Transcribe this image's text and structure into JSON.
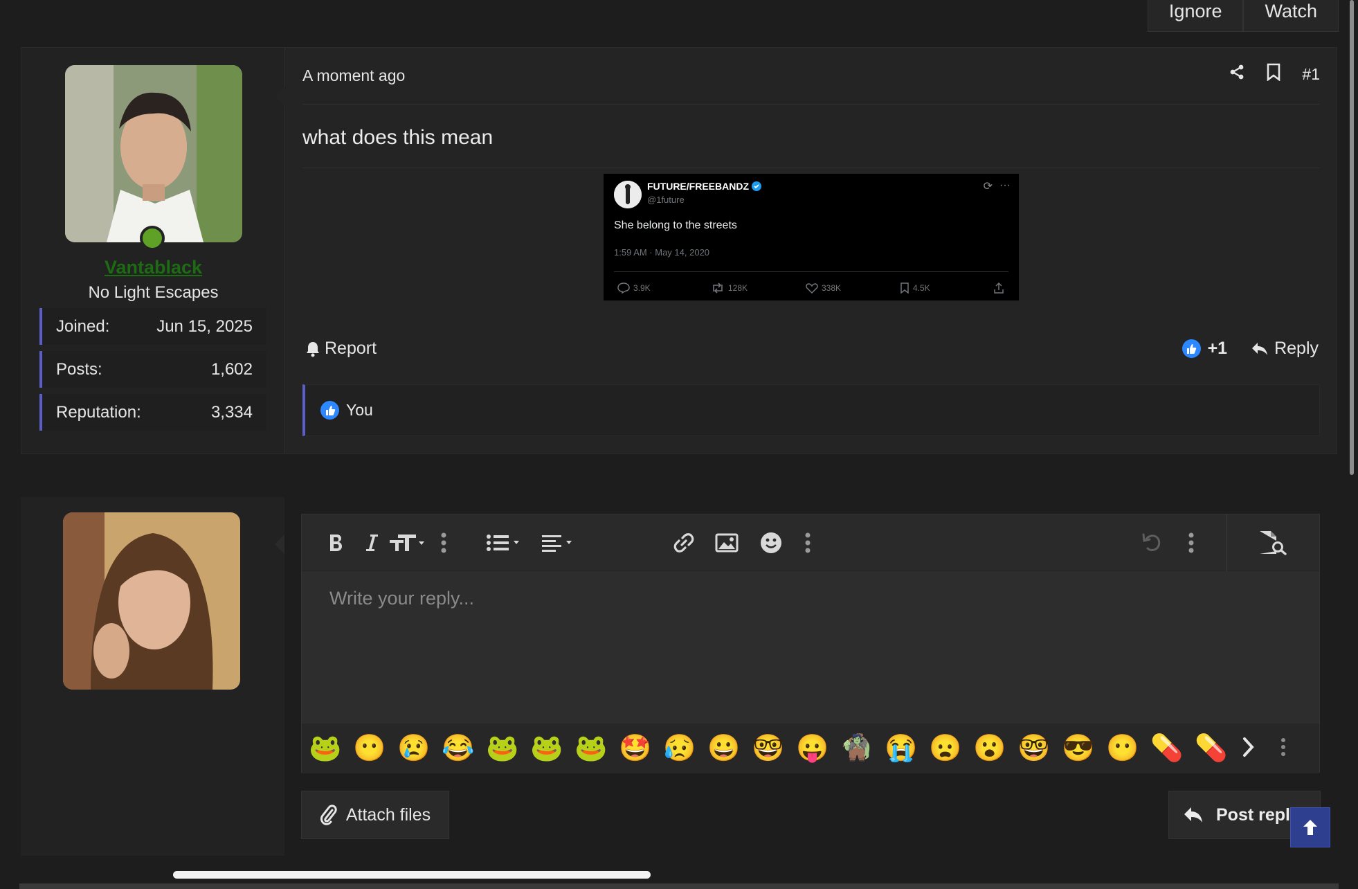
{
  "topbar": {
    "ignore_label": "Ignore",
    "watch_label": "Watch"
  },
  "post": {
    "date": "A moment ago",
    "number": "#1",
    "text": "what does this mean",
    "author": {
      "username": "Vantablack",
      "title": "No Light Escapes",
      "stats": [
        {
          "label": "Joined:",
          "value": "Jun 15, 2025"
        },
        {
          "label": "Posts:",
          "value": "1,602"
        },
        {
          "label": "Reputation:",
          "value": "3,334"
        }
      ]
    },
    "embed": {
      "name": "FUTURE/FREEBANDZ",
      "handle": "@1future",
      "text": "She belong to the streets",
      "time": "1:59 AM · May 14, 2020",
      "replies": "3.9K",
      "retweets": "128K",
      "likes": "338K",
      "bookmarks": "4.5K"
    },
    "report_label": "Report",
    "like_count": "+1",
    "reply_label": "Reply",
    "reactions_text": "You"
  },
  "editor": {
    "placeholder": "Write your reply...",
    "attach_label": "Attach files",
    "post_reply_label": "Post reply",
    "emojis": [
      "🐸",
      "😶",
      "😢",
      "😂",
      "🐸",
      "🐸",
      "🐸",
      "🤩",
      "😥",
      "😀",
      "🤓",
      "😛",
      "🧌",
      "😭",
      "😦",
      "😮",
      "🤓",
      "😎",
      "😶",
      "💊",
      "💊"
    ]
  },
  "colors": {
    "accent": "#5b5ec7",
    "online": "#5fa126",
    "username": "#1d6b12",
    "like": "#2d88ff",
    "scroll_top": "#2f3f8f"
  }
}
